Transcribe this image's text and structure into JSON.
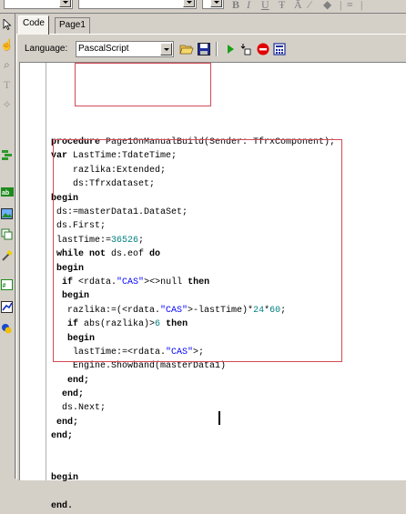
{
  "toolbar": {
    "format_buttons": [
      "B",
      "I",
      "U"
    ]
  },
  "tabs": [
    {
      "label": "Code"
    },
    {
      "label": "Page1"
    }
  ],
  "language_bar": {
    "label": "Language:",
    "selected": "PascalScript"
  },
  "code_lines": [
    {
      "segments": [
        {
          "t": "procedure",
          "c": "kw"
        },
        {
          "t": " Page1OnManualBuild(Sender: TfrxComponent);"
        }
      ]
    },
    {
      "segments": [
        {
          "t": "var",
          "c": "kw"
        },
        {
          "t": " LastTime:TdateTime;"
        }
      ]
    },
    {
      "segments": [
        {
          "t": "    razlika:Extended;"
        }
      ]
    },
    {
      "segments": [
        {
          "t": "    ds:Tfrxdataset;"
        }
      ]
    },
    {
      "segments": [
        {
          "t": "begin",
          "c": "kw"
        }
      ]
    },
    {
      "segments": [
        {
          "t": " ds:=masterData1.DataSet;"
        }
      ]
    },
    {
      "segments": [
        {
          "t": " ds.First;"
        }
      ]
    },
    {
      "segments": [
        {
          "t": " lastTime:="
        },
        {
          "t": "36526",
          "c": "num"
        },
        {
          "t": ";"
        }
      ]
    },
    {
      "segments": [
        {
          "t": " "
        },
        {
          "t": "while not",
          "c": "kw"
        },
        {
          "t": " ds.eof "
        },
        {
          "t": "do",
          "c": "kw"
        }
      ]
    },
    {
      "segments": [
        {
          "t": " "
        },
        {
          "t": "begin",
          "c": "kw"
        }
      ]
    },
    {
      "segments": [
        {
          "t": "  "
        },
        {
          "t": "if",
          "c": "kw"
        },
        {
          "t": " <rdata."
        },
        {
          "t": "\"CAS\"",
          "c": "str"
        },
        {
          "t": "><>null "
        },
        {
          "t": "then",
          "c": "kw"
        }
      ]
    },
    {
      "segments": [
        {
          "t": "  "
        },
        {
          "t": "begin",
          "c": "kw"
        }
      ]
    },
    {
      "segments": [
        {
          "t": "   razlika:=(<rdata."
        },
        {
          "t": "\"CAS\"",
          "c": "str"
        },
        {
          "t": ">-lastTime)*"
        },
        {
          "t": "24",
          "c": "num"
        },
        {
          "t": "*"
        },
        {
          "t": "60",
          "c": "num"
        },
        {
          "t": ";"
        }
      ]
    },
    {
      "segments": [
        {
          "t": "   "
        },
        {
          "t": "if",
          "c": "kw"
        },
        {
          "t": " abs(razlika)>"
        },
        {
          "t": "6",
          "c": "num"
        },
        {
          "t": " "
        },
        {
          "t": "then",
          "c": "kw"
        }
      ]
    },
    {
      "segments": [
        {
          "t": "   "
        },
        {
          "t": "begin",
          "c": "kw"
        }
      ]
    },
    {
      "segments": [
        {
          "t": "    lastTime:=<rdata."
        },
        {
          "t": "\"CAS\"",
          "c": "str"
        },
        {
          "t": ">;"
        }
      ]
    },
    {
      "segments": [
        {
          "t": "    Engine.Showband(masterData1)"
        }
      ]
    },
    {
      "segments": [
        {
          "t": "   "
        },
        {
          "t": "end;",
          "c": "kw"
        }
      ]
    },
    {
      "segments": [
        {
          "t": "  "
        },
        {
          "t": "end;",
          "c": "kw"
        }
      ]
    },
    {
      "segments": [
        {
          "t": "  ds.Next;"
        }
      ]
    },
    {
      "segments": [
        {
          "t": " "
        },
        {
          "t": "end;",
          "c": "kw"
        }
      ]
    },
    {
      "segments": [
        {
          "t": "end;",
          "c": "kw"
        }
      ]
    },
    {
      "segments": [
        {
          "t": ""
        }
      ]
    },
    {
      "segments": [
        {
          "t": ""
        }
      ]
    },
    {
      "segments": [
        {
          "t": "begin",
          "c": "kw"
        }
      ]
    },
    {
      "segments": [
        {
          "t": ""
        }
      ]
    },
    {
      "segments": [
        {
          "t": "end.",
          "c": "kw"
        }
      ]
    }
  ],
  "icons": {
    "open": "open-folder-icon",
    "save": "save-icon",
    "run": "run-icon",
    "step": "step-icon",
    "stop": "stop-icon",
    "evaluate": "evaluate-icon"
  },
  "colors": {
    "highlight_box": "#d34a55",
    "keyword": "#000000",
    "number": "#008080",
    "string": "#0000ff",
    "run_green": "#1aa01a",
    "stop_red": "#e00000"
  }
}
